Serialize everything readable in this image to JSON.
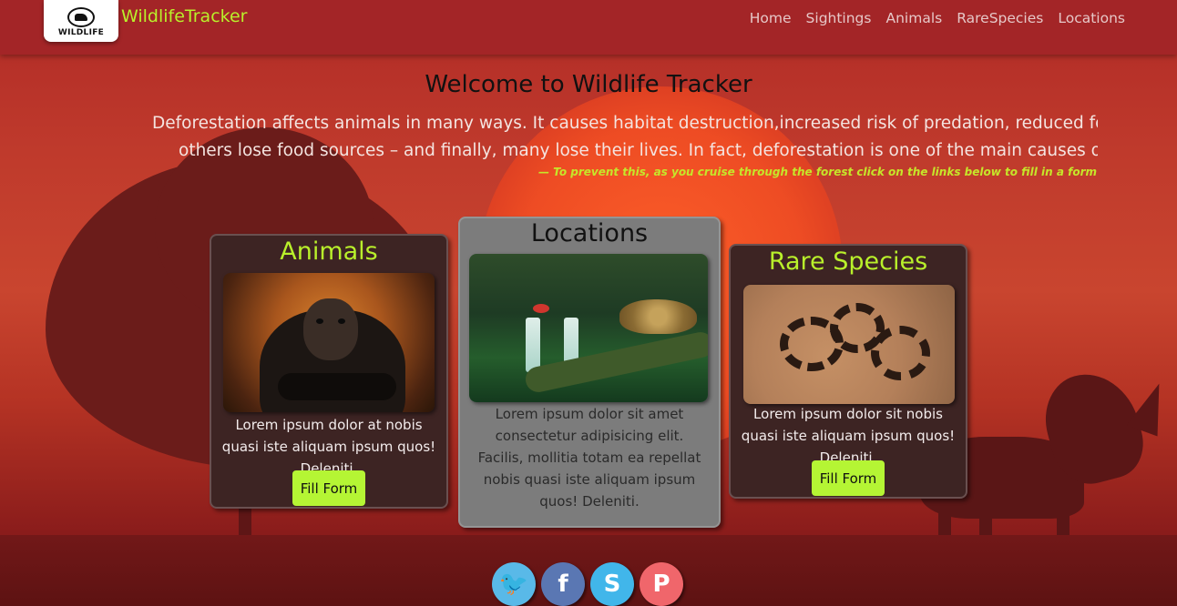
{
  "navbar": {
    "logo_text": "WILDLIFE",
    "brand": "WildlifeTracker",
    "links": [
      "Home",
      "Sightings",
      "Animals",
      "RareSpecies",
      "Locations"
    ]
  },
  "hero": {
    "title": "Welcome to Wildlife Tracker",
    "line1": "Deforestation affects animals in many ways. It causes habitat destruction,increased risk of predation, reduced food",
    "line2": "others lose food sources – and finally, many lose their lives. In fact, deforestation is one of the main causes of ex",
    "footer": "— To prevent this, as you cruise through the forest click on the links below to fill in a form for the an"
  },
  "cards": {
    "animals": {
      "title": "Animals",
      "text": "Lorem ipsum dolor at nobis quasi iste aliquam ipsum quos! Deleniti.",
      "button": "Fill Form"
    },
    "locations": {
      "title": "Locations",
      "text": "Lorem ipsum dolor sit amet consectetur adipisicing elit. Facilis, mollitia totam ea repellat nobis quasi iste aliquam ipsum quos! Deleniti."
    },
    "rare": {
      "title": "Rare Species",
      "text": "Lorem ipsum dolor sit nobis quasi iste aliquam ipsum quos! Deleniti.",
      "button": "Fill Form"
    }
  },
  "social": {
    "icons": [
      "twitter-icon",
      "facebook-icon",
      "skype-icon",
      "pinterest-icon"
    ],
    "glyphs": [
      "🐦",
      "f",
      "S",
      "P"
    ]
  },
  "colors": {
    "navbar": "#a32527",
    "accent": "#b9f02b",
    "button": "#b5f534",
    "card_dark": "#3d2423",
    "card_grey": "#7c7c7c"
  }
}
